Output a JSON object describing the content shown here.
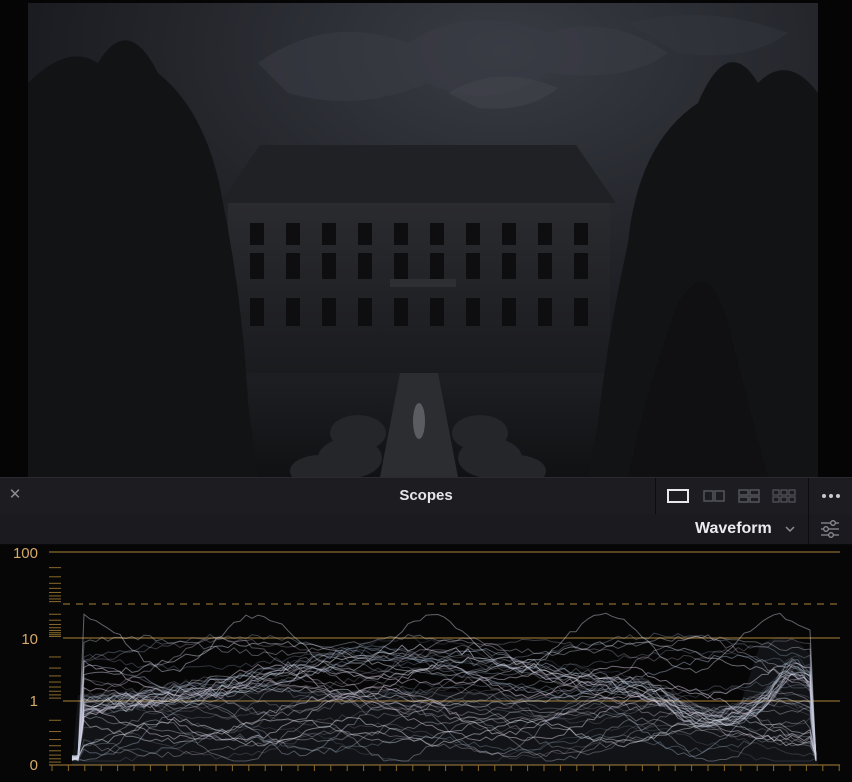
{
  "viewer": {
    "image_alt": ""
  },
  "panel": {
    "title": "Scopes",
    "close_icon": "close-icon",
    "layout_options": [
      "single-view-icon",
      "dual-view-icon",
      "quad-view-icon",
      "multi-view-icon"
    ],
    "active_layout": "single-view-icon",
    "more_icon": "more-options-icon"
  },
  "toolbar": {
    "scope_type": "Waveform",
    "dropdown_icon": "chevron-down-icon",
    "settings_icon": "settings-sliders-icon"
  },
  "waveform": {
    "y_labels": [
      "100",
      "10",
      "1",
      "0"
    ],
    "scale": "log",
    "colors": {
      "guide": "#8a6a2c",
      "labels": "#d7aa68",
      "trace": "#c8d4e6"
    }
  }
}
